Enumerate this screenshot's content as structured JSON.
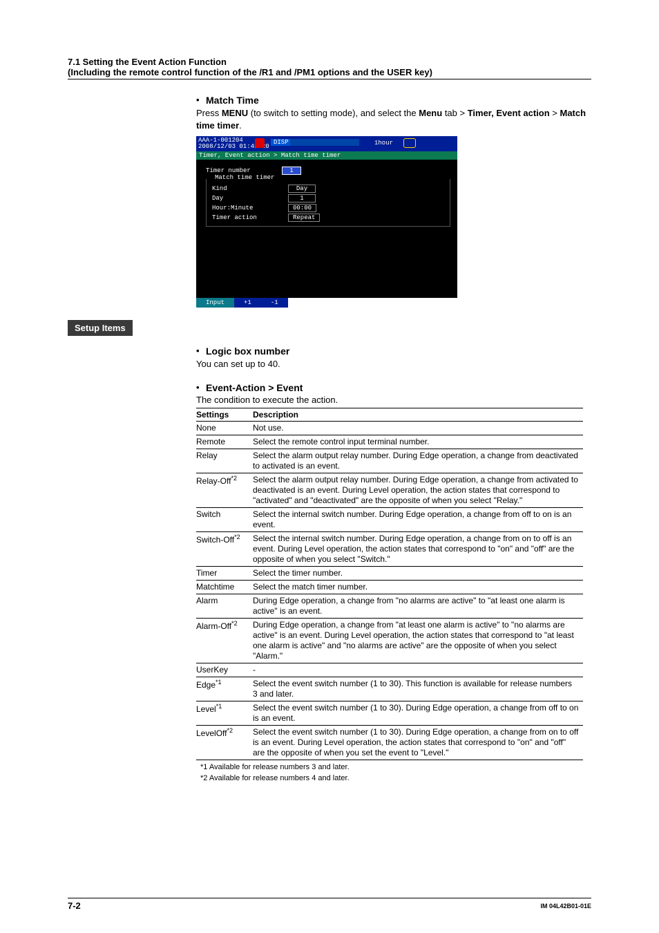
{
  "header": {
    "line1": "7.1  Setting the Event Action Function",
    "line2": "(Including the remote control function of the /R1 and /PM1 options and the USER key)"
  },
  "match_time": {
    "title": "Match Time",
    "para_pre": "Press ",
    "menu1": "MENU",
    "para_mid1": " (to switch to setting mode), and select the ",
    "menu2": "Menu",
    "para_mid2": " tab > ",
    "bold1": "Timer, Event action",
    "gt": " > ",
    "bold2": "Match time timer",
    "period": "."
  },
  "screenshot": {
    "id_line": "AAA-1-001204\n2008/12/03 01:45:20",
    "disp": "DISP",
    "hour": "1hour",
    "breadcrumb": "Timer, Event action > Match time timer",
    "timer_number_label": "Timer number",
    "timer_number_val": "1",
    "group_title": "Match time timer",
    "kind_label": "Kind",
    "kind_val": "Day",
    "day_label": "Day",
    "day_val": "1",
    "hm_label": "Hour:Minute",
    "hm_val": "00:00",
    "ta_label": "Timer action",
    "ta_val": "Repeat",
    "btn_input": "Input",
    "btn_p1": "+1",
    "btn_m1": "-1"
  },
  "setup_items_label": "Setup Items",
  "logic_box": {
    "title": "Logic box number",
    "text": "You can set up to 40."
  },
  "event_action": {
    "title": "Event-Action > Event",
    "intro": "The condition to execute the action.",
    "col1": "Settings",
    "col2": "Description",
    "rows": [
      {
        "s": "None",
        "d": "Not use."
      },
      {
        "s": "Remote",
        "d": "Select the remote control input terminal number."
      },
      {
        "s": "Relay",
        "d": "Select the alarm output relay number. During Edge operation, a change from deactivated to activated is an event."
      },
      {
        "s": "Relay-Off",
        "sup": "*2",
        "d": "Select the alarm output relay number. During Edge operation, a change from activated to deactivated is an event. During Level operation, the action states that correspond to \"activated\" and \"deactivated\" are the opposite of when you select \"Relay.\""
      },
      {
        "s": "Switch",
        "d": "Select the internal switch number. During Edge operation, a change from off to on is an event."
      },
      {
        "s": "Switch-Off",
        "sup": "*2",
        "d": "Select the internal switch number. During Edge operation, a change from on to off is an event. During Level operation, the action states that correspond to \"on\" and \"off\" are the opposite of when you select \"Switch.\""
      },
      {
        "s": "Timer",
        "d": "Select the timer number."
      },
      {
        "s": "Matchtime",
        "d": "Select the match timer number."
      },
      {
        "s": "Alarm",
        "d": "During Edge operation, a change from \"no alarms are active\" to \"at least one alarm is active\" is an event."
      },
      {
        "s": "Alarm-Off",
        "sup": "*2",
        "d": "During Edge operation, a change from \"at least one alarm is active\" to \"no alarms are active\" is an event. During Level operation, the action states that correspond to \"at least one alarm is active\" and \"no alarms are active\" are the opposite of when you select \"Alarm.\""
      },
      {
        "s": "UserKey",
        "d": "-"
      },
      {
        "s": "Edge",
        "sup": "*1",
        "d": "Select the event switch number (1 to 30). This function is available for release numbers 3 and later."
      },
      {
        "s": "Level",
        "sup": "*1",
        "d": "Select the event switch number (1 to 30). During Edge operation, a change from off to on is an event."
      },
      {
        "s": "LevelOff",
        "sup": "*2",
        "d": "Select the event switch number (1 to 30). During Edge operation, a change from on to off is an event. During Level operation, the action states that correspond to \"on\" and \"off\" are the opposite of when you set the event to \"Level.\""
      }
    ],
    "footnote1": "*1  Available for release numbers 3 and later.",
    "footnote2": "*2  Available for release numbers 4 and later."
  },
  "footer": {
    "page": "7-2",
    "doc": "IM 04L42B01-01E"
  }
}
